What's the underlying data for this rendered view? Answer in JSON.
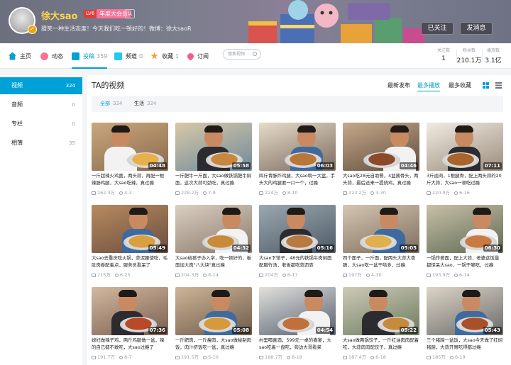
{
  "header": {
    "username": "徐大sao",
    "level_badge": "LV6",
    "vip_badge": "年度大会员",
    "small_badge": "认",
    "signature": "猜笑一种生活态度！今天我们吃一顿好的！微博：徐大saoR",
    "follow_label": "已关注",
    "message_label": "发消息"
  },
  "nav": {
    "items": [
      {
        "label": "主页",
        "count": "",
        "icon": "home-icon"
      },
      {
        "label": "动态",
        "count": "",
        "icon": "feed-icon"
      },
      {
        "label": "投稿",
        "count": "359",
        "icon": "upload-icon"
      },
      {
        "label": "频道",
        "count": "0",
        "icon": "channel-icon"
      },
      {
        "label": "收藏",
        "count": "1",
        "icon": "star-icon"
      },
      {
        "label": "订阅",
        "count": "",
        "icon": "heart-icon"
      }
    ],
    "search_placeholder": "搜索视频",
    "stats": [
      {
        "label": "关注数",
        "value": "1"
      },
      {
        "label": "粉丝数",
        "value": "210.1万"
      },
      {
        "label": "播放数",
        "value": "3.1亿"
      }
    ]
  },
  "sidebar": {
    "items": [
      {
        "label": "视频",
        "count": "324"
      },
      {
        "label": "音频",
        "count": "0"
      },
      {
        "label": "专栏",
        "count": "0"
      },
      {
        "label": "相簿",
        "count": "35"
      }
    ]
  },
  "main": {
    "title": "TA的视频",
    "sort_options": [
      "最新发布",
      "最多播放",
      "最多收藏"
    ],
    "filters": [
      {
        "label": "全部",
        "count": "324"
      },
      {
        "label": "生活",
        "count": "324"
      }
    ]
  },
  "videos": [
    {
      "duration": "04:48",
      "title": "一斤超辣火鸡面，两头蒜，再配一根辣肠鸡腿，大sao吃辣，真过瘾",
      "plays": "262.3万",
      "date": "4-3"
    },
    {
      "duration": "05:58",
      "title": "一斤肥牛一斤面，大sao做铁锅肥牛焖面，这次大蒜可劲吃，真过瘾",
      "plays": "228.2万",
      "date": "7-9"
    },
    {
      "duration": "06:03",
      "title": "四斤青酥炸鸡腿，大sao啃一大盆，手头大的鸡腿要一口一个，过瘾",
      "plays": "224万",
      "date": "8-10"
    },
    {
      "duration": "04:46",
      "title": "大sao吃28元自助餐，4盆酱骨头，两头蒜，最后还来一提烧鸡，真过瘾",
      "plays": "223.2万",
      "date": "3-30"
    },
    {
      "duration": "07:11",
      "title": "3斤卤肉，1根腿骨，配上两头蒜的20斤大蒜，大sao一顿吃过瘾",
      "plays": "220.9万",
      "date": "6-16"
    },
    {
      "duration": "05:49",
      "title": "大sao去重庆吃火锅，蒜泥腰使吃，毛肚肉卷配着点，服务员看呆了",
      "plays": "215万",
      "date": "6-25"
    },
    {
      "duration": "04:52",
      "title": "大sao给孩子办入学，吃一顿好的，板面加大肉\"八大块\"真过瘾",
      "plays": "204.3万",
      "date": "8-14"
    },
    {
      "duration": "05:16",
      "title": "大sao下馆子，48元的铁锅牛肉焖面配腊竹汤，老板都吃蒜沥哀",
      "plays": "204万",
      "date": "6-17"
    },
    {
      "duration": "05:05",
      "title": "四个面子，一斤面，配两头大蒜大杏肠，大sao吃一盆干啃多，过瘾",
      "plays": "197万",
      "date": "4-30"
    },
    {
      "duration": "06:30",
      "title": "一锅炸酱面，配上大蒜，老婆这饭量都惊呆大sao，一锅干够吃，过瘾",
      "plays": "193.9万",
      "date": "6-14"
    },
    {
      "duration": "07:36",
      "title": "媳妇做辣子鸡，两斤鸡腿做一盆，辣的自己都不敢吃，大sao过瘾了",
      "plays": "191.7万",
      "date": "8-7"
    },
    {
      "duration": "05:08",
      "title": "一斤肥肉，一斤瘦肉，大sao做秘制肉饭，肉汁挤饭吃一盆，真过瘾",
      "plays": "191.5万",
      "date": "5-10"
    },
    {
      "duration": "04:54",
      "title": "村里喝喜酒，599元一桌的喜宴，大sao吃着一盘吃，旁边大哥看呆",
      "plays": "188.7万",
      "date": "8-18"
    },
    {
      "duration": "05:22",
      "title": "大sao做两锅饺子，一斤红油肉肉配着吃，大蒜肉肉配饺子，真过瘾",
      "plays": "187.4万",
      "date": "6-18"
    },
    {
      "duration": "05:43",
      "title": "三个猪蹄一盆饭，大sao今天做了红焖猪蹄，大蒜开胃吃得都过瘾",
      "plays": "185万",
      "date": "6-19"
    }
  ]
}
